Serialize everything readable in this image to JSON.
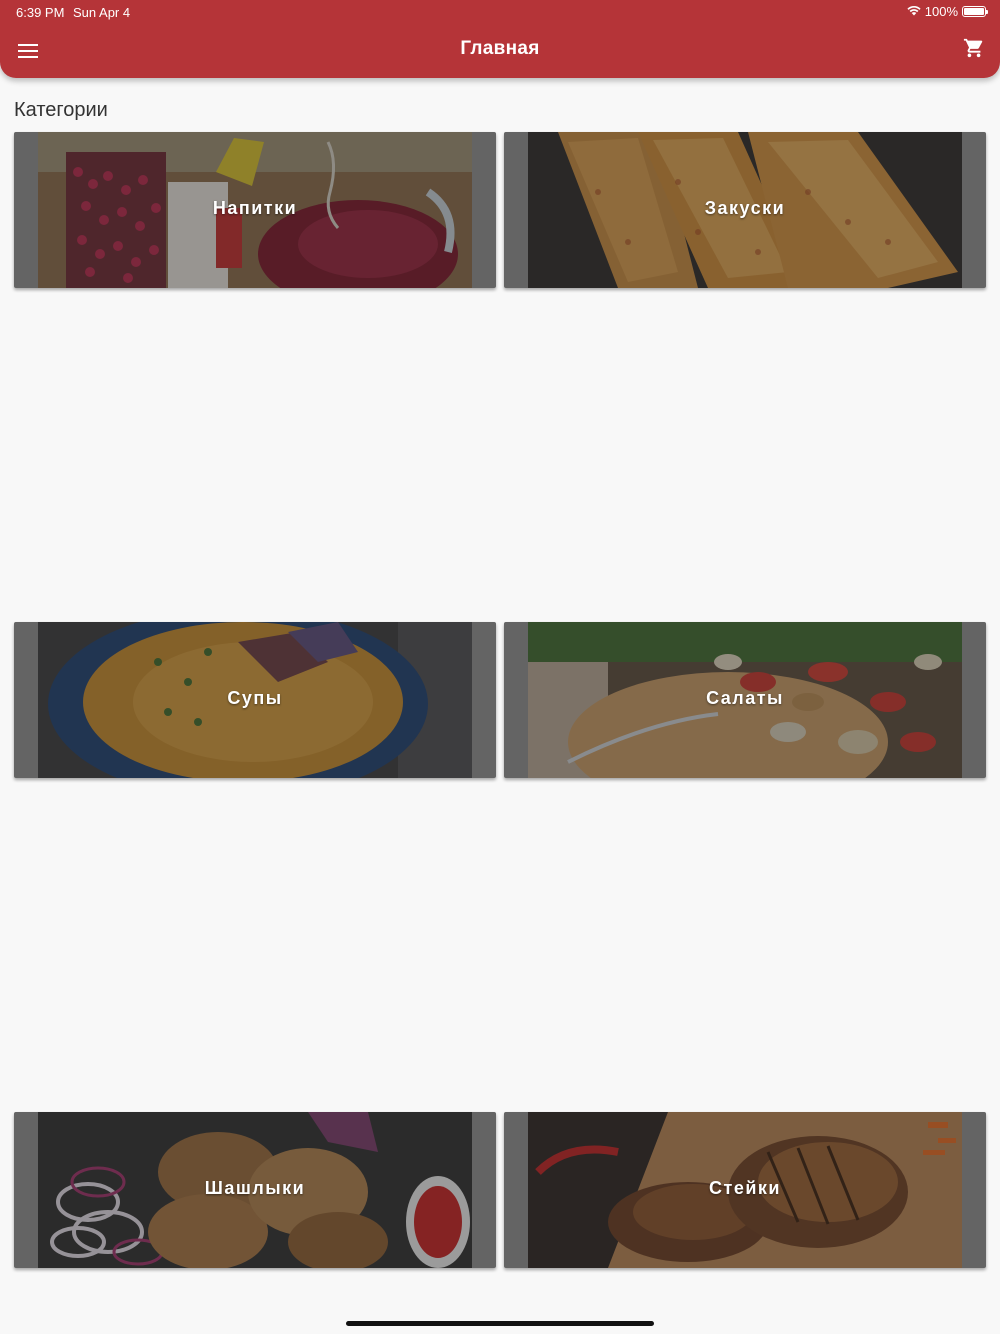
{
  "status": {
    "time": "6:39 PM",
    "date": "Sun Apr 4",
    "battery": "100%"
  },
  "appbar": {
    "title": "Главная",
    "color": "#b53438",
    "menu_icon": "menu-icon",
    "cart_icon": "cart-icon"
  },
  "section": {
    "title": "Категории"
  },
  "categories": [
    {
      "label": "Напитки",
      "photo": "drinks-photo"
    },
    {
      "label": "Закуски",
      "photo": "snacks-photo"
    },
    {
      "label": "Супы",
      "photo": "soups-photo"
    },
    {
      "label": "Салаты",
      "photo": "salads-photo"
    },
    {
      "label": "Шашлыки",
      "photo": "shashlik-photo"
    },
    {
      "label": "Стейки",
      "photo": "steaks-photo"
    }
  ]
}
